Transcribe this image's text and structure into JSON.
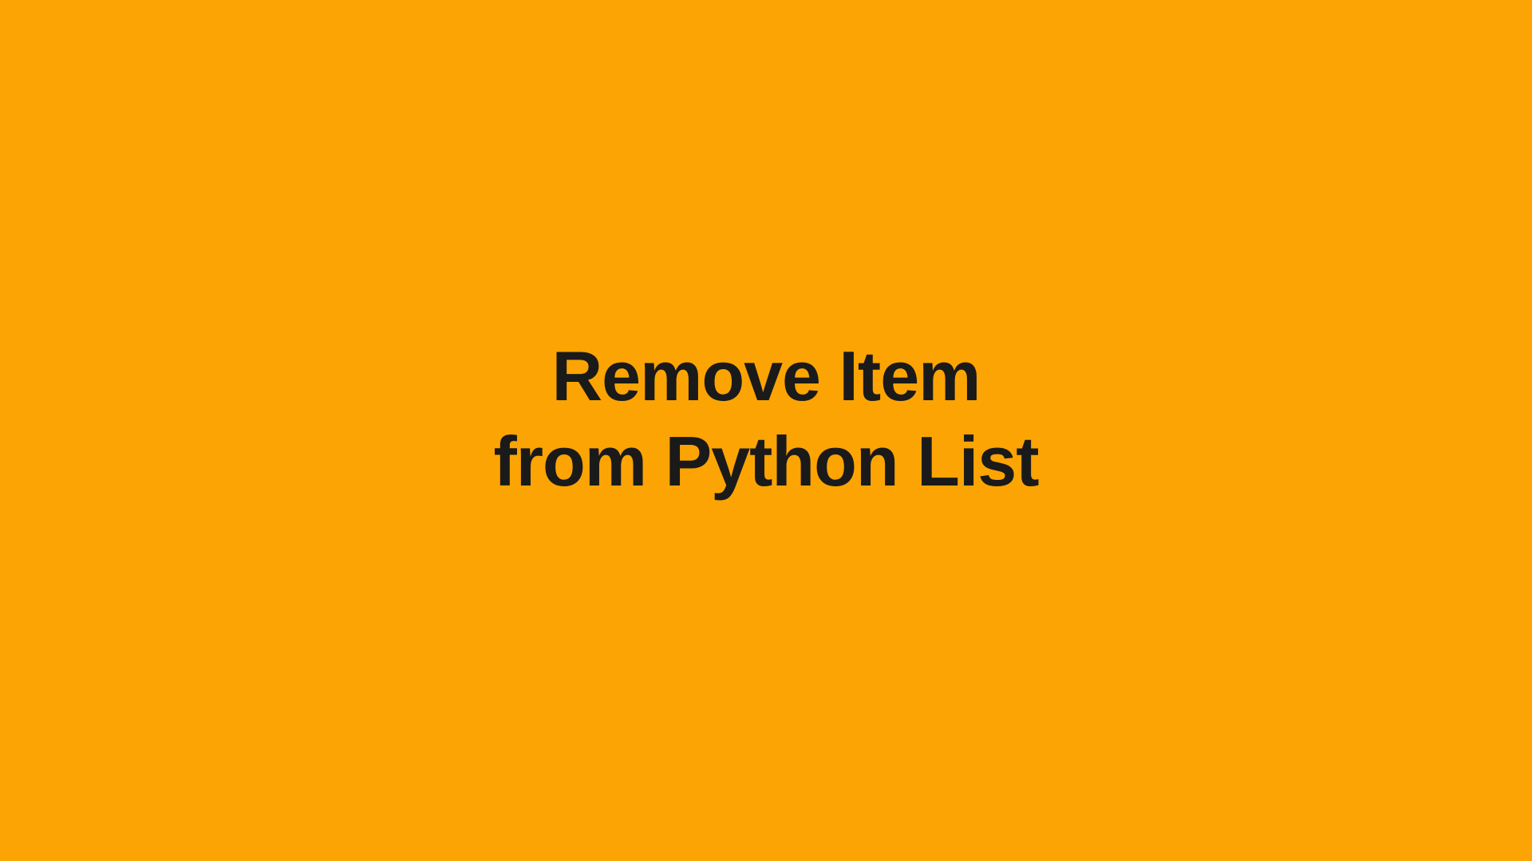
{
  "title": {
    "line1": "Remove Item",
    "line2": "from Python List"
  }
}
